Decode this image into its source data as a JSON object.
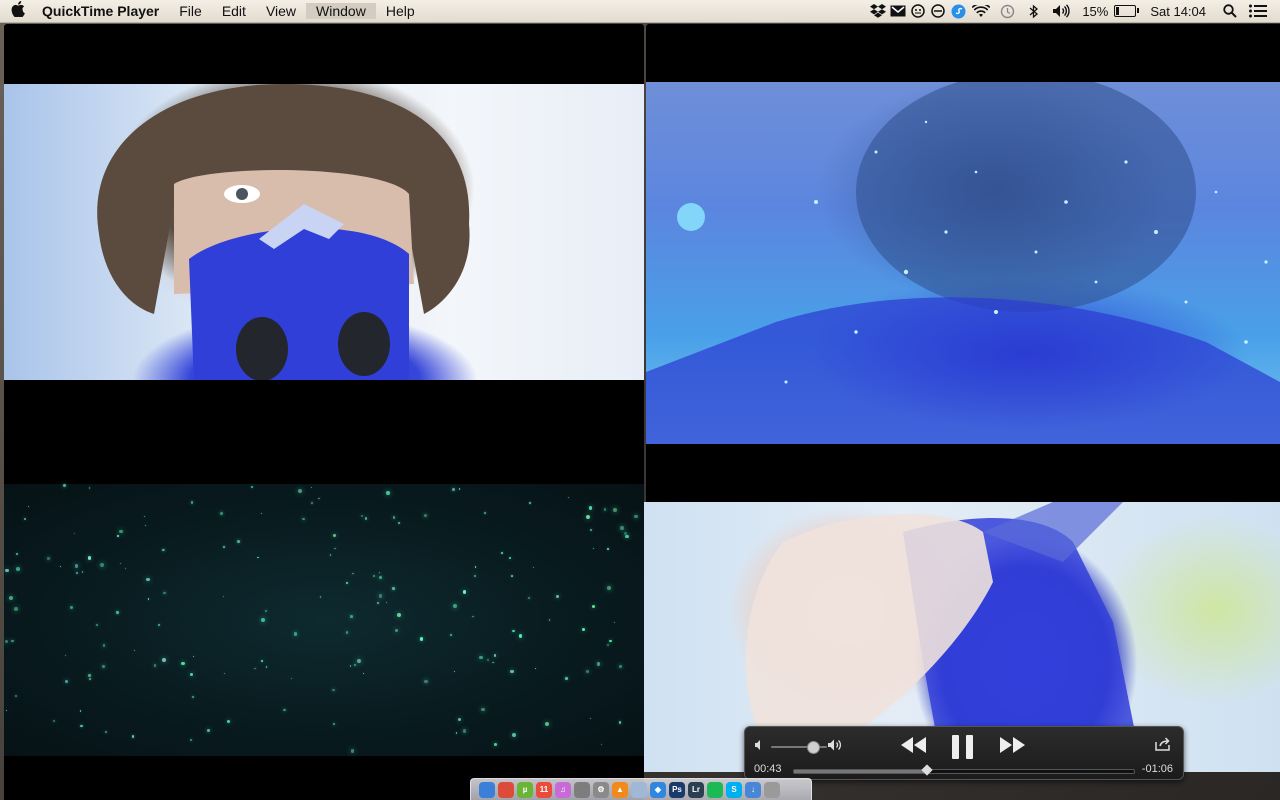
{
  "menubar": {
    "app_name": "QuickTime Player",
    "items": [
      "File",
      "Edit",
      "View",
      "Window",
      "Help"
    ],
    "active_item": "Window",
    "status": {
      "battery_percent": "15%",
      "clock": "Sat 14:04"
    }
  },
  "player": {
    "time_elapsed": "00:43",
    "time_remaining": "-01:06",
    "progress": 0.39,
    "volume": 0.75
  },
  "dock": {
    "icons": [
      {
        "name": "finder-icon",
        "color": "#3b7fd9",
        "glyph": ""
      },
      {
        "name": "chrome-icon",
        "color": "#dd4b39",
        "glyph": ""
      },
      {
        "name": "utorrent-icon",
        "color": "#6bb536",
        "glyph": "µ"
      },
      {
        "name": "calendar-icon",
        "color": "#e94b3c",
        "glyph": "11"
      },
      {
        "name": "itunes-icon",
        "color": "#c86bd9",
        "glyph": "♫"
      },
      {
        "name": "messages-icon",
        "color": "#7d7d7d",
        "glyph": ""
      },
      {
        "name": "system-prefs-icon",
        "color": "#8a8a8a",
        "glyph": "⚙"
      },
      {
        "name": "vlc-icon",
        "color": "#f08a1d",
        "glyph": "▲"
      },
      {
        "name": "preview-icon",
        "color": "#9fb8d6",
        "glyph": ""
      },
      {
        "name": "dropbox-icon",
        "color": "#2f88e0",
        "glyph": "◆"
      },
      {
        "name": "photoshop-icon",
        "color": "#1a3a6c",
        "glyph": "Ps"
      },
      {
        "name": "lightroom-icon",
        "color": "#2b3e52",
        "glyph": "Lr"
      },
      {
        "name": "spotify-icon",
        "color": "#1db954",
        "glyph": ""
      },
      {
        "name": "skype-icon",
        "color": "#00aff0",
        "glyph": "S"
      },
      {
        "name": "downloads-icon",
        "color": "#4a86d8",
        "glyph": "↓"
      },
      {
        "name": "trash-icon",
        "color": "#9a9a9a",
        "glyph": ""
      }
    ]
  }
}
